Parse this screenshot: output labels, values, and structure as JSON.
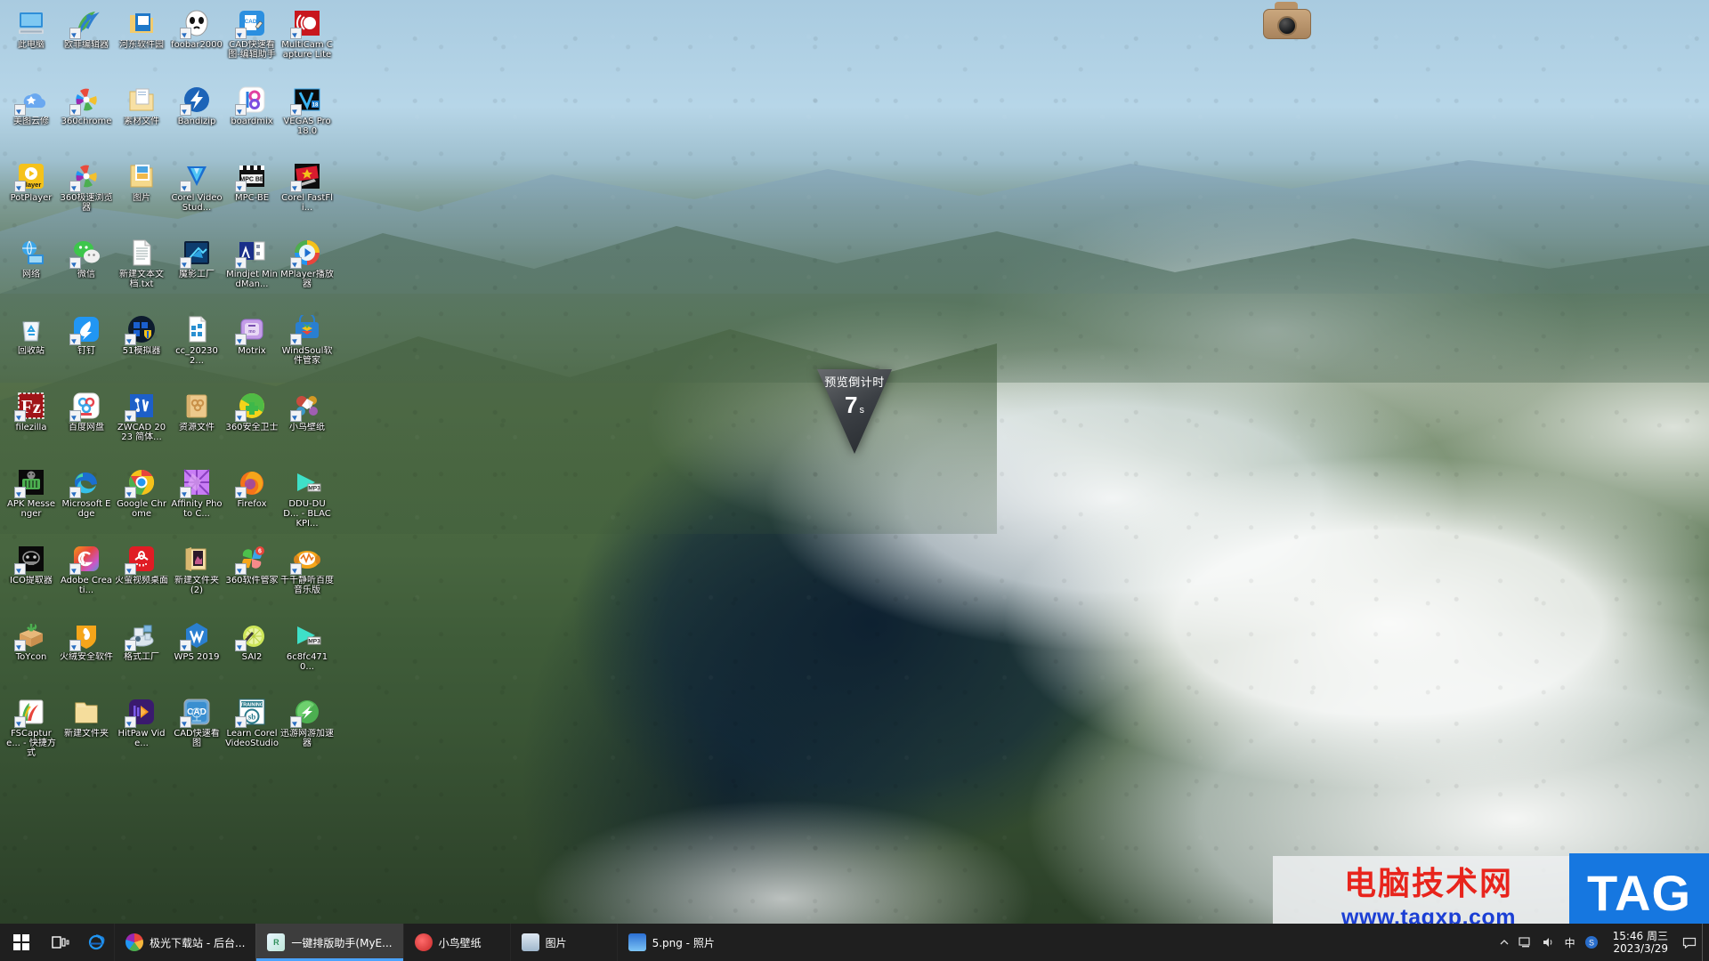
{
  "desktop": {
    "icons": [
      {
        "label": "此电脑",
        "icon": "this-pc-icon",
        "shortcut": false,
        "art": "monitor"
      },
      {
        "label": "欧菲编辑器",
        "icon": "ofi-editor-icon",
        "shortcut": true,
        "art": "r-logo"
      },
      {
        "label": "河东软件园",
        "icon": "hedong-software-icon",
        "shortcut": false,
        "art": "folder-blue"
      },
      {
        "label": "foobar2000",
        "icon": "foobar2000-icon",
        "shortcut": true,
        "art": "foobar"
      },
      {
        "label": "CAD快速看图-编辑助手",
        "icon": "cad-fast-view-icon",
        "shortcut": true,
        "art": "cad-blue"
      },
      {
        "label": "MultiCam Capture Lite",
        "icon": "multicam-capture-icon",
        "shortcut": true,
        "art": "multicam"
      },
      {
        "label": "美图云修",
        "icon": "meitu-yunxiu-icon",
        "shortcut": true,
        "art": "meitu"
      },
      {
        "label": "360chrome",
        "icon": "360chrome-icon",
        "shortcut": true,
        "art": "pinwheel"
      },
      {
        "label": "素材文件",
        "icon": "material-files-folder-icon",
        "shortcut": false,
        "art": "folder-doc"
      },
      {
        "label": "Bandizip",
        "icon": "bandizip-icon",
        "shortcut": true,
        "art": "bandizip"
      },
      {
        "label": "boardmix",
        "icon": "boardmix-icon",
        "shortcut": true,
        "art": "boardmix"
      },
      {
        "label": "VEGAS Pro 18.0",
        "icon": "vegas-pro-icon",
        "shortcut": true,
        "art": "vegas"
      },
      {
        "label": "PotPlayer",
        "icon": "potplayer-icon",
        "shortcut": true,
        "art": "potplayer"
      },
      {
        "label": "360极速浏览器",
        "icon": "360-speed-browser-icon",
        "shortcut": true,
        "art": "pinwheel"
      },
      {
        "label": "图片",
        "icon": "pictures-folder-icon",
        "shortcut": false,
        "art": "pictures"
      },
      {
        "label": "Corel VideoStud...",
        "icon": "corel-videostudio-icon",
        "shortcut": true,
        "art": "corel-v"
      },
      {
        "label": "MPC-BE",
        "icon": "mpc-be-icon",
        "shortcut": true,
        "art": "mpcbe"
      },
      {
        "label": "Corel FastFli...",
        "icon": "corel-fastflick-icon",
        "shortcut": true,
        "art": "fastflick"
      },
      {
        "label": "网络",
        "icon": "network-icon",
        "shortcut": false,
        "art": "network"
      },
      {
        "label": "微信",
        "icon": "wechat-icon",
        "shortcut": true,
        "art": "wechat"
      },
      {
        "label": "新建文本文档.txt",
        "icon": "text-document-icon",
        "shortcut": false,
        "art": "txtdoc"
      },
      {
        "label": "魔影工厂",
        "icon": "moying-factory-icon",
        "shortcut": true,
        "art": "moying"
      },
      {
        "label": "Mindjet MindMan...",
        "icon": "mindjet-mindmanager-icon",
        "shortcut": true,
        "art": "mindjet"
      },
      {
        "label": "MPlayer播放器",
        "icon": "mplayer-icon",
        "shortcut": true,
        "art": "mplayer"
      },
      {
        "label": "回收站",
        "icon": "recycle-bin-icon",
        "shortcut": false,
        "art": "recycle"
      },
      {
        "label": "钉钉",
        "icon": "dingtalk-icon",
        "shortcut": true,
        "art": "dingtalk"
      },
      {
        "label": "51模拟器",
        "icon": "51-emulator-icon",
        "shortcut": true,
        "art": "emulator51"
      },
      {
        "label": "cc_202302...",
        "icon": "cc-file-icon",
        "shortcut": false,
        "art": "ccfile"
      },
      {
        "label": "Motrix",
        "icon": "motrix-icon",
        "shortcut": true,
        "art": "motrix"
      },
      {
        "label": "WindSoul软件管家",
        "icon": "windsoul-software-manager-icon",
        "shortcut": true,
        "art": "windsoul"
      },
      {
        "label": "filezilla",
        "icon": "filezilla-icon",
        "shortcut": true,
        "art": "filezilla"
      },
      {
        "label": "百度网盘",
        "icon": "baidu-netdisk-icon",
        "shortcut": true,
        "art": "baidupan"
      },
      {
        "label": "ZWCAD 2023 简体...",
        "icon": "zwcad-icon",
        "shortcut": true,
        "art": "zwcad"
      },
      {
        "label": "资源文件",
        "icon": "resource-files-folder-icon",
        "shortcut": false,
        "art": "resfolder"
      },
      {
        "label": "360安全卫士",
        "icon": "360-safe-guard-icon",
        "shortcut": true,
        "art": "360safe"
      },
      {
        "label": "小鸟壁纸",
        "icon": "bird-wallpaper-icon",
        "shortcut": true,
        "art": "birdwall"
      },
      {
        "label": "APK Messenger",
        "icon": "apk-messenger-icon",
        "shortcut": true,
        "art": "apk"
      },
      {
        "label": "Microsoft Edge",
        "icon": "microsoft-edge-icon",
        "shortcut": true,
        "art": "edge"
      },
      {
        "label": "Google Chrome",
        "icon": "google-chrome-icon",
        "shortcut": true,
        "art": "chrome"
      },
      {
        "label": "Affinity Photo C...",
        "icon": "affinity-photo-icon",
        "shortcut": true,
        "art": "affinity"
      },
      {
        "label": "Firefox",
        "icon": "firefox-icon",
        "shortcut": true,
        "art": "firefox"
      },
      {
        "label": "DDU-DU D... - BLACKPI...",
        "icon": "mp3-file-icon",
        "shortcut": false,
        "art": "mp3"
      },
      {
        "label": "ICO提取器",
        "icon": "ico-extractor-icon",
        "shortcut": true,
        "art": "icoext"
      },
      {
        "label": "Adobe Creati...",
        "icon": "adobe-creative-cloud-icon",
        "shortcut": true,
        "art": "adobecc"
      },
      {
        "label": "火萤视频桌面",
        "icon": "huoying-video-desktop-icon",
        "shortcut": true,
        "art": "huoying"
      },
      {
        "label": "新建文件夹(2)",
        "icon": "new-folder-2-icon",
        "shortcut": false,
        "art": "folder-pic"
      },
      {
        "label": "360软件管家",
        "icon": "360-software-manager-icon",
        "shortcut": true,
        "art": "360soft"
      },
      {
        "label": "千千静听百度音乐版",
        "icon": "qianqian-music-icon",
        "shortcut": true,
        "art": "qianqian"
      },
      {
        "label": "ToYcon",
        "icon": "toycon-icon",
        "shortcut": true,
        "art": "toycon"
      },
      {
        "label": "火绒安全软件",
        "icon": "huorong-security-icon",
        "shortcut": true,
        "art": "huorong"
      },
      {
        "label": "格式工厂",
        "icon": "format-factory-icon",
        "shortcut": true,
        "art": "formatfactory"
      },
      {
        "label": "WPS 2019",
        "icon": "wps-2019-icon",
        "shortcut": true,
        "art": "wps"
      },
      {
        "label": "SAI2",
        "icon": "sai2-icon",
        "shortcut": true,
        "art": "sai2"
      },
      {
        "label": "6c8fc4710...",
        "icon": "mp3-file-icon",
        "shortcut": false,
        "art": "mp3"
      },
      {
        "label": "FSCapture... - 快捷方式",
        "icon": "fscapture-shortcut-icon",
        "shortcut": true,
        "art": "fscapture"
      },
      {
        "label": "新建文件夹",
        "icon": "new-folder-icon",
        "shortcut": false,
        "art": "folder-plain"
      },
      {
        "label": "HitPaw Vide...",
        "icon": "hitpaw-video-icon",
        "shortcut": true,
        "art": "hitpaw"
      },
      {
        "label": "CAD快速看图",
        "icon": "cad-fast-view-2-icon",
        "shortcut": true,
        "art": "cadfast2"
      },
      {
        "label": "Learn Corel VideoStudio",
        "icon": "learn-corel-videostudio-icon",
        "shortcut": true,
        "art": "learncorel"
      },
      {
        "label": "迅游网游加速器",
        "icon": "xunyou-accelerator-icon",
        "shortcut": true,
        "art": "xunyou"
      }
    ]
  },
  "countdown": {
    "title": "预览倒计时",
    "value": "7",
    "unit": "s"
  },
  "watermark": {
    "site_name": "电脑技术网",
    "url": "www.tagxp.com",
    "tag": "TAG"
  },
  "taskbar": {
    "start_label": "开始",
    "search_label": "任务视图",
    "pinned": [
      {
        "label": "Internet Explorer",
        "icon": "internet-explorer-icon"
      }
    ],
    "tasks": [
      {
        "label": "极光下载站 - 后台...",
        "icon": "360-browser-icon",
        "active": false
      },
      {
        "label": "一键排版助手(MyE...",
        "icon": "typesetting-assistant-icon",
        "active": true
      },
      {
        "label": "小鸟壁纸",
        "icon": "bird-wallpaper-icon",
        "active": false
      },
      {
        "label": "图片",
        "icon": "photos-app-icon",
        "active": false
      },
      {
        "label": "5.png - 照片",
        "icon": "photo-viewer-icon",
        "active": false
      }
    ],
    "tray": {
      "overflow_icon": "show-hidden-icons-chevron",
      "ime_label": "中",
      "sogou_icon": "sogou-input-icon",
      "network_icon": "network-tray-icon",
      "volume_icon": "volume-tray-icon",
      "time": "15:46 周三",
      "date": "2023/3/29",
      "notification_icon": "action-center-icon"
    }
  }
}
